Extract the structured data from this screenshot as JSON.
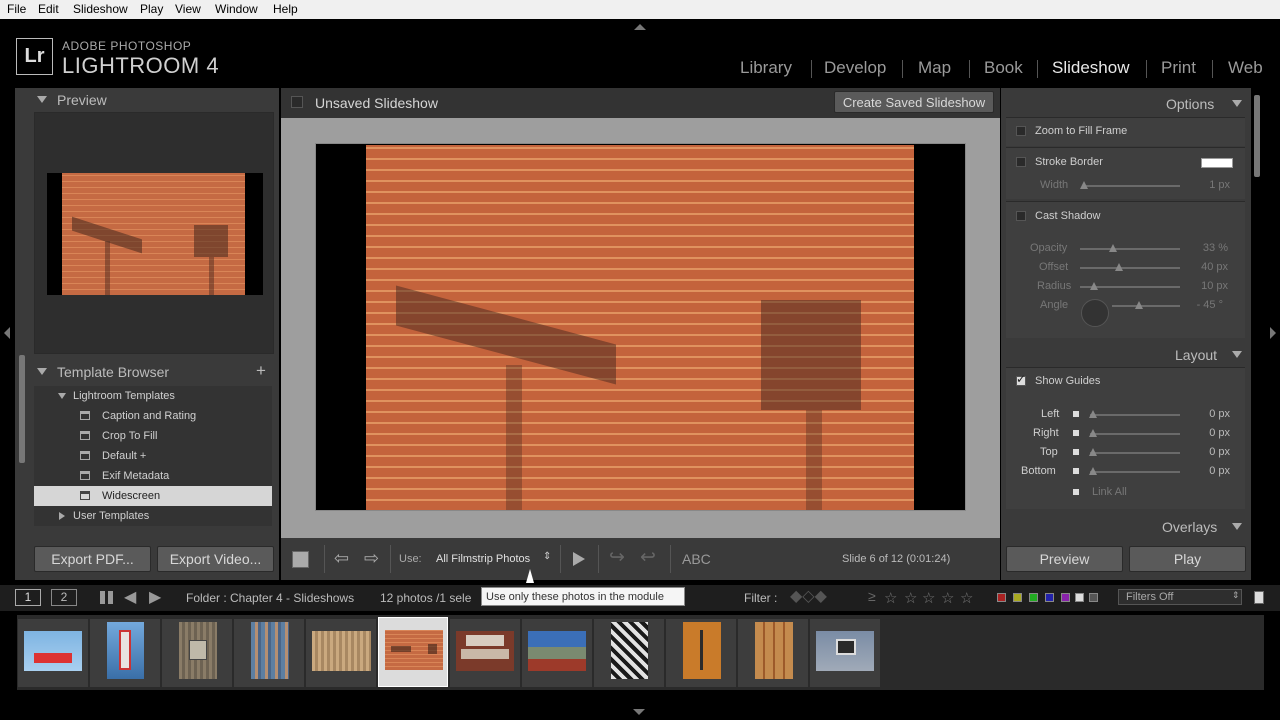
{
  "menu": [
    "File",
    "Edit",
    "Slideshow",
    "Play",
    "View",
    "Window",
    "Help"
  ],
  "brand": {
    "logo": "Lr",
    "line1": "ADOBE PHOTOSHOP",
    "line2": "LIGHTROOM 4"
  },
  "modules": [
    "Library",
    "Develop",
    "Map",
    "Book",
    "Slideshow",
    "Print",
    "Web"
  ],
  "active_module": "Slideshow",
  "left": {
    "preview_title": "Preview",
    "template_browser_title": "Template Browser",
    "add_icon": "+",
    "lightroom_templates": "Lightroom Templates",
    "templates": [
      "Caption and Rating",
      "Crop To Fill",
      "Default +",
      "Exif Metadata",
      "Widescreen"
    ],
    "selected_template": "Widescreen",
    "user_templates": "User Templates",
    "export_pdf": "Export PDF...",
    "export_video": "Export Video..."
  },
  "center": {
    "slideshow_title": "Unsaved Slideshow",
    "create_saved": "Create Saved Slideshow",
    "use_label": "Use:",
    "use_value": "All Filmstrip Photos",
    "abc": "ABC",
    "slide_info": "Slide 6 of 12 (0:01:24)"
  },
  "right": {
    "options_title": "Options",
    "zoom_to_fill": "Zoom to Fill Frame",
    "stroke_border": "Stroke Border",
    "width_label": "Width",
    "width_value": "1 px",
    "cast_shadow": "Cast Shadow",
    "shadow": [
      {
        "label": "Opacity",
        "value": "33 %"
      },
      {
        "label": "Offset",
        "value": "40 px"
      },
      {
        "label": "Radius",
        "value": "10 px"
      },
      {
        "label": "Angle",
        "value": "- 45 °"
      }
    ],
    "layout_title": "Layout",
    "show_guides": "Show Guides",
    "margins": [
      {
        "label": "Left",
        "value": "0 px"
      },
      {
        "label": "Right",
        "value": "0 px"
      },
      {
        "label": "Top",
        "value": "0 px"
      },
      {
        "label": "Bottom",
        "value": "0 px"
      }
    ],
    "link_all": "Link All",
    "overlays_title": "Overlays",
    "preview_btn": "Preview",
    "play_btn": "Play"
  },
  "filmstrip": {
    "page1": "1",
    "page2": "2",
    "source": "Folder : Chapter 4 - Slideshows",
    "count": "12 photos /1 sele",
    "tooltip": "Use only these photos in the module",
    "filter_label": "Filter :",
    "filters_off": "Filters Off",
    "selected_index": 5
  },
  "colors": {
    "accent": "#e8e8e8",
    "panel": "#3a3a3a",
    "bg": "#000000",
    "selected_row": "#d6d6d6"
  }
}
